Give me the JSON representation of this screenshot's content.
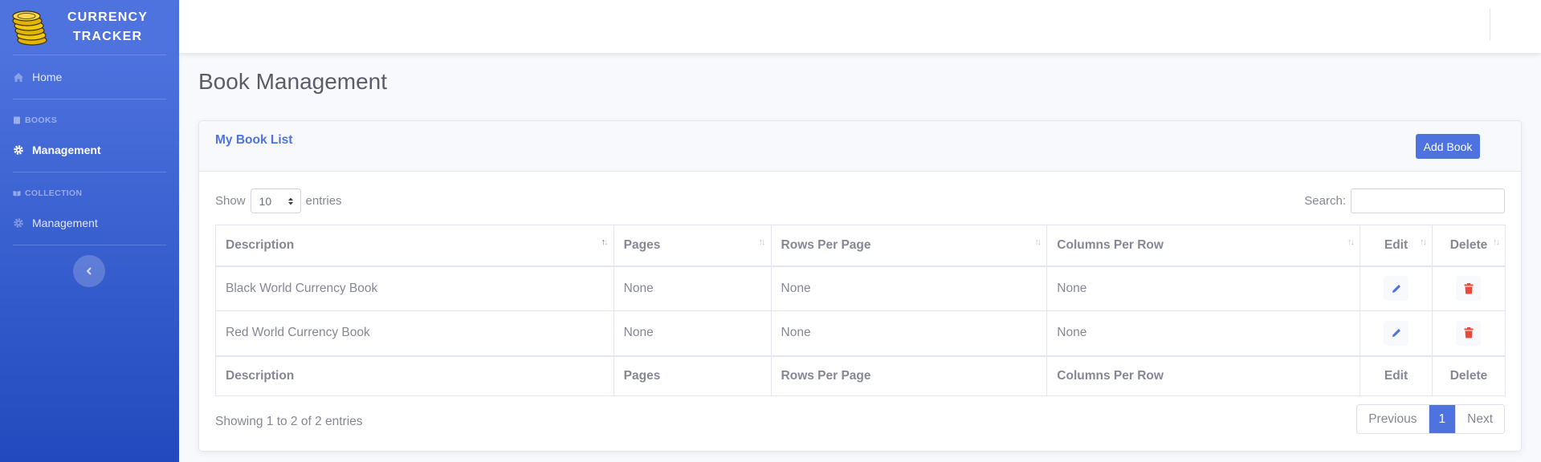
{
  "brand": {
    "line1": "CURRENCY",
    "line2": "TRACKER"
  },
  "sidebar": {
    "home": "Home",
    "books_heading": "Books",
    "books_management": "Management",
    "collection_heading": "Collection",
    "collection_management": "Management"
  },
  "page": {
    "title": "Book Management"
  },
  "card": {
    "title": "My Book List",
    "add_button": "Add Book"
  },
  "table_controls": {
    "show_label": "Show",
    "entries_value": "10",
    "entries_label": "entries",
    "search_label": "Search:",
    "search_value": ""
  },
  "table": {
    "columns": [
      "Description",
      "Pages",
      "Rows Per Page",
      "Columns Per Row",
      "Edit",
      "Delete"
    ],
    "rows": [
      {
        "description": "Black World Currency Book",
        "pages": "None",
        "rows_per_page": "None",
        "columns_per_row": "None"
      },
      {
        "description": "Red World Currency Book",
        "pages": "None",
        "rows_per_page": "None",
        "columns_per_row": "None"
      }
    ]
  },
  "footer": {
    "info": "Showing 1 to 2 of 2 entries",
    "previous": "Previous",
    "current_page": "1",
    "next": "Next"
  },
  "colors": {
    "primary": "#4e73df",
    "danger": "#e74a3b",
    "text": "#858796"
  }
}
